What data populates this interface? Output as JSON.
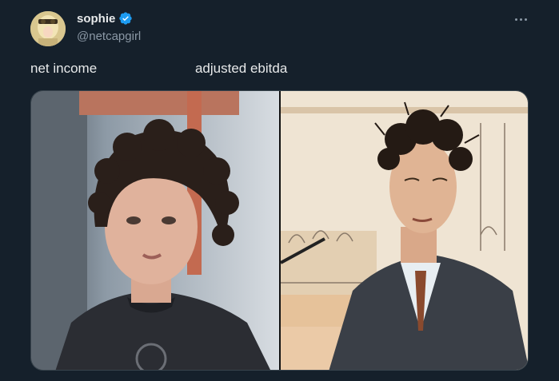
{
  "author": {
    "display_name": "sophie",
    "handle": "@netcapgirl",
    "verified": true,
    "verified_color": "#1d9bf0"
  },
  "more_icon": "ellipsis-icon",
  "tweet": {
    "text": "net income                          adjusted ebitda"
  },
  "media": {
    "images": [
      {
        "label": "left-photo",
        "description_icon": "photo"
      },
      {
        "label": "right-sketch",
        "description_icon": "illustration"
      }
    ]
  },
  "colors": {
    "background": "#15202b",
    "text_primary": "#e7e9ea",
    "text_secondary": "#8b98a5"
  }
}
